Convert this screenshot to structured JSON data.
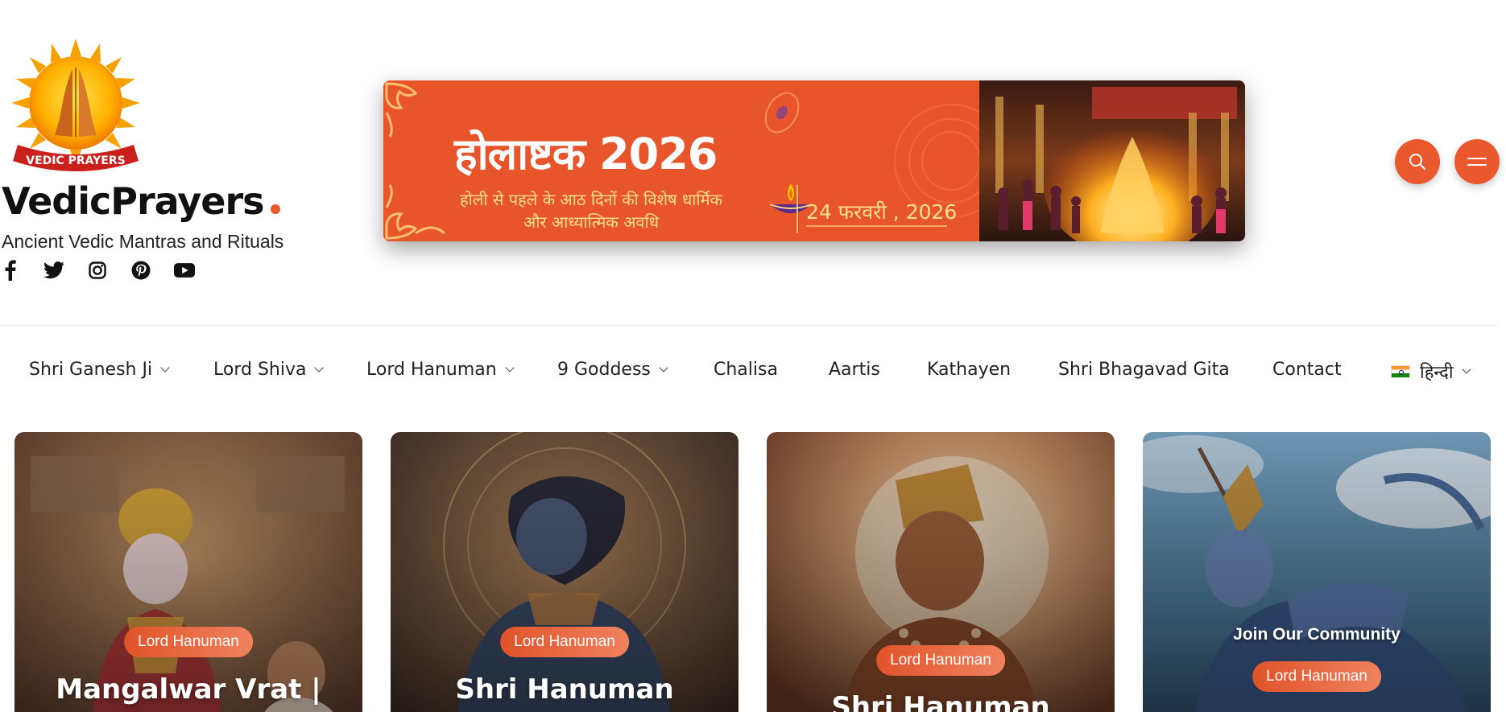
{
  "site": {
    "logo_text": "VEDIC PRAYERS",
    "title": "VedicPrayers",
    "tagline": "Ancient Vedic Mantras and Rituals",
    "accent": "#e9592d"
  },
  "socials": [
    {
      "icon": "facebook-icon"
    },
    {
      "icon": "twitter-icon"
    },
    {
      "icon": "instagram-icon"
    },
    {
      "icon": "pinterest-icon"
    },
    {
      "icon": "youtube-icon"
    }
  ],
  "banner": {
    "title": "होलाष्टक 2026",
    "subtitle_line1": "होली से पहले के आठ दिनों की विशेष धार्मिक",
    "subtitle_line2": "और आध्यात्मिक अवधि",
    "date": "24 फरवरी , 2026"
  },
  "header_buttons": {
    "search_icon": "search-icon",
    "menu_icon": "menu-icon"
  },
  "nav": {
    "items": [
      {
        "label": "Shri Ganesh Ji",
        "dropdown": true
      },
      {
        "label": "Lord Shiva",
        "dropdown": true
      },
      {
        "label": "Lord Hanuman",
        "dropdown": true
      },
      {
        "label": "9 Goddess",
        "dropdown": true
      },
      {
        "label": "Chalisa",
        "dropdown": false
      },
      {
        "label": "Aartis",
        "dropdown": false
      },
      {
        "label": "Kathayen",
        "dropdown": false
      },
      {
        "label": "Shri Bhagavad Gita",
        "dropdown": false
      },
      {
        "label": "Contact",
        "dropdown": false
      },
      {
        "label": "हिन्दी",
        "dropdown": true
      }
    ]
  },
  "cards": [
    {
      "category": "Lord Hanuman",
      "title": "Mangalwar Vrat |"
    },
    {
      "category": "Lord Hanuman",
      "title": "Shri Hanuman"
    },
    {
      "category": "Lord Hanuman",
      "title": "Shri Hanuman"
    },
    {
      "overlay": "Join Our Community",
      "category": "Lord Hanuman"
    }
  ]
}
